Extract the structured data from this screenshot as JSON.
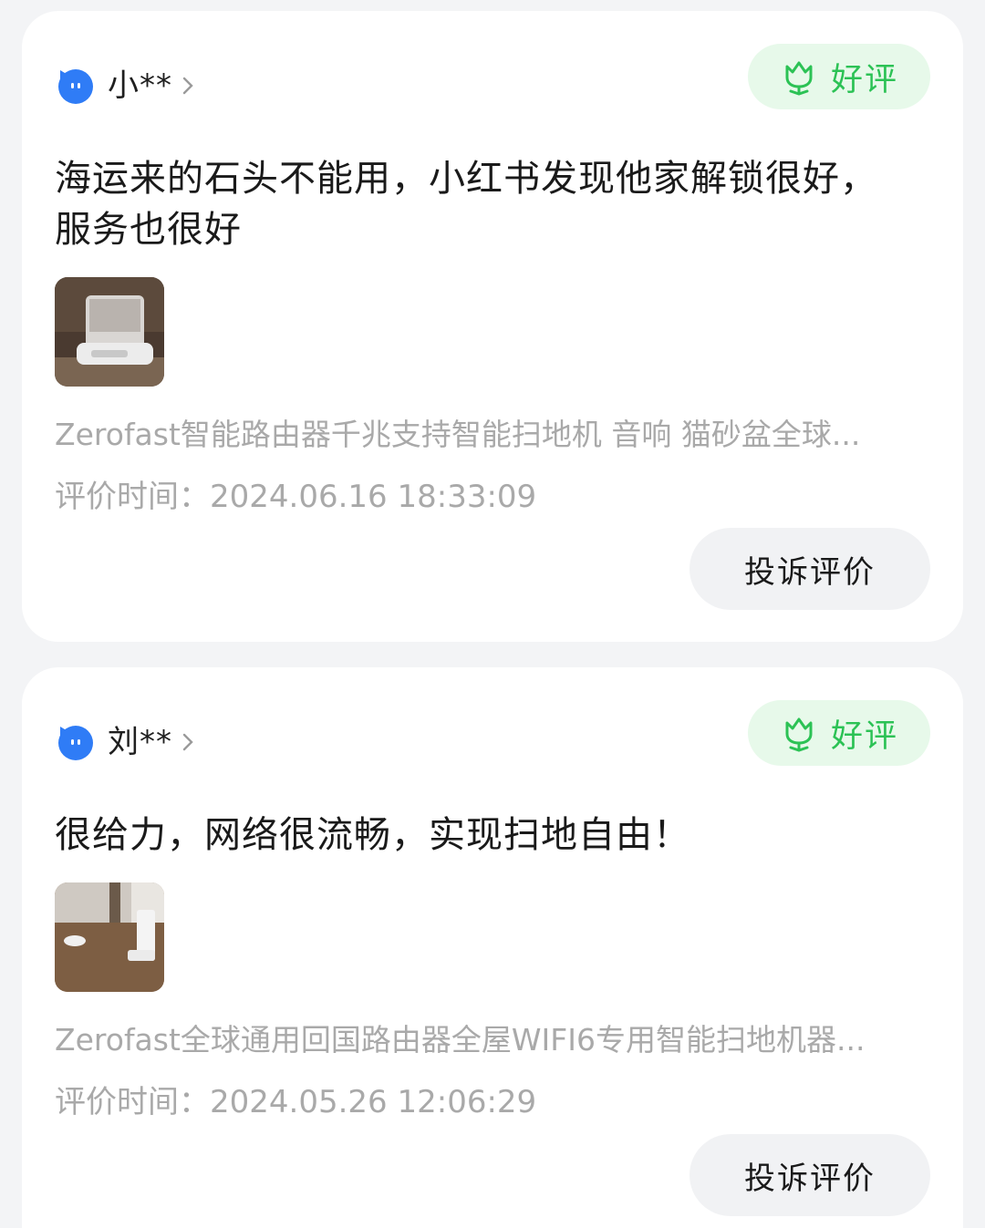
{
  "reviews": [
    {
      "username": "小**",
      "badge": "好评",
      "text": "海运来的石头不能用，小红书发现他家解锁很好，服务也很好",
      "product": "Zerofast智能路由器千兆支持智能扫地机 音响 猫砂盆全球...",
      "time": "评价时间：2024.06.16 18:33:09",
      "complain": "投诉评价"
    },
    {
      "username": "刘**",
      "badge": "好评",
      "text": "很给力，网络很流畅，实现扫地自由！",
      "product": "Zerofast全球通用回国路由器全屋WIFI6专用智能扫地机器...",
      "time": "评价时间：2024.05.26 12:06:29",
      "complain": "投诉评价"
    }
  ],
  "icons": {
    "avatar": "blue-cat-avatar-icon",
    "chevron": "chevron-right-icon",
    "badge": "tulip-icon"
  },
  "colors": {
    "badge_text": "#2cc255",
    "badge_bg": "#e7f9ea",
    "avatar_blue": "#2f7cf6",
    "muted_text": "#a9a9a9"
  }
}
